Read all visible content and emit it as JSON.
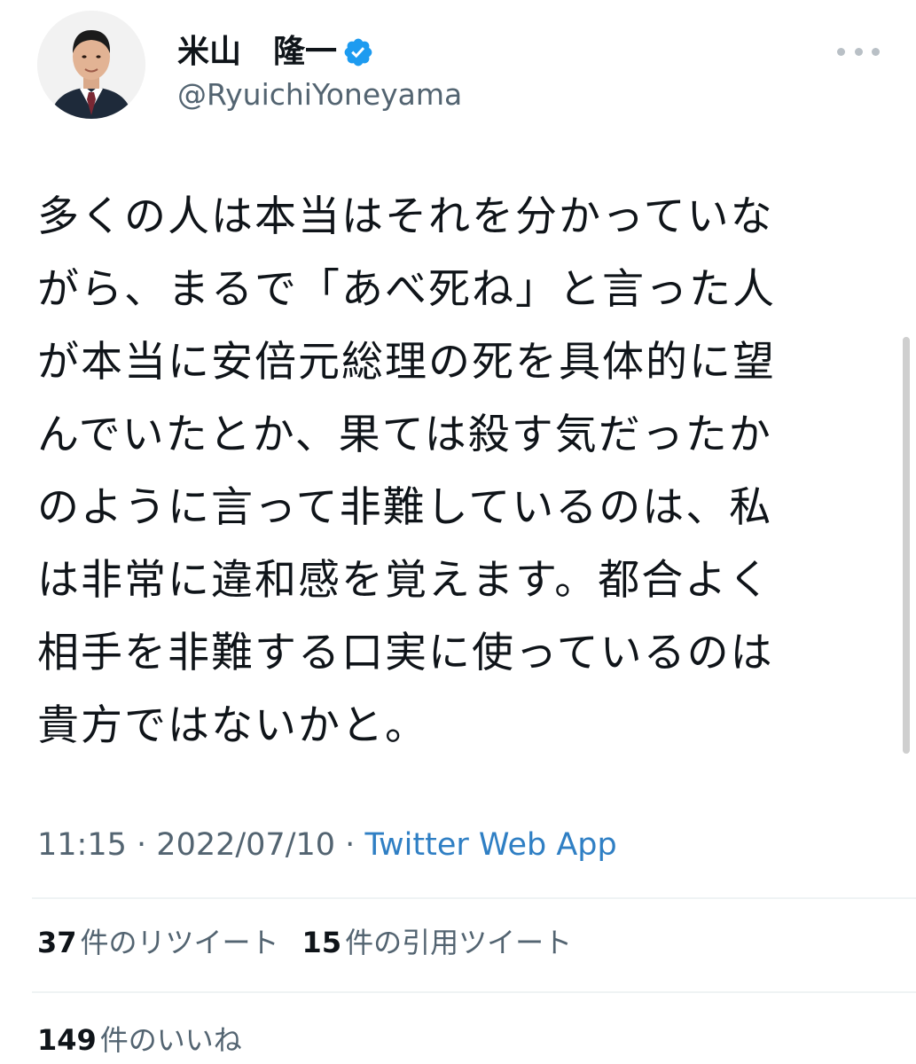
{
  "author": {
    "display_name": "米山　隆一",
    "handle": "@RyuichiYoneyama",
    "verified_color": "#1d9bf0"
  },
  "tweet": {
    "lines": [
      "多くの人は本当はそれを分かっていな",
      "がら、まるで「あべ死ね」と言った人",
      "が本当に安倍元総理の死を具体的に望",
      "んでいたとか、果ては殺す気だったか",
      "のように言って非難しているのは、私",
      "は非常に違和感を覚えます。都合よく",
      "相手を非難する口実に使っているのは",
      "貴方ではないかと。"
    ],
    "time": "11:15",
    "separator": "·",
    "date": "2022/07/10",
    "source": "Twitter Web App"
  },
  "stats": {
    "retweets_count": "37",
    "retweets_label": "件のリツイート",
    "quotes_count": "15",
    "quotes_label": "件の引用ツイート",
    "likes_count": "149",
    "likes_label": "件のいいね"
  },
  "icons": {
    "avatar": "avatar-photo",
    "verified": "verified-badge-icon",
    "more": "more-options-icon"
  },
  "colors": {
    "link": "#2f7fc4",
    "secondary_text": "#536471",
    "verified": "#1d9bf0"
  }
}
